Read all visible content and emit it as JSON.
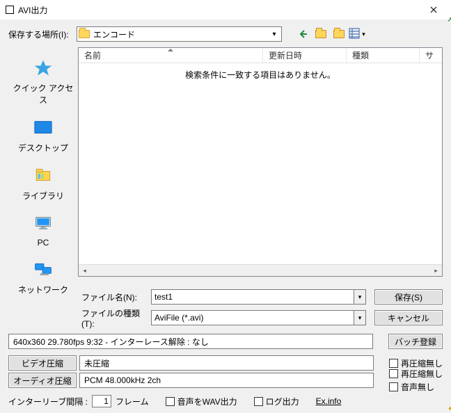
{
  "window": {
    "title": "AVI出力"
  },
  "location": {
    "label": "保存する場所(I):",
    "value": "エンコード"
  },
  "places": {
    "quick": "クイック アクセス",
    "desktop": "デスクトップ",
    "libraries": "ライブラリ",
    "pc": "PC",
    "network": "ネットワーク"
  },
  "listview": {
    "col_name": "名前",
    "col_date": "更新日時",
    "col_type": "種類",
    "col_size": "サ",
    "empty": "検索条件に一致する項目はありません。"
  },
  "file": {
    "name_label": "ファイル名(N):",
    "name_value": "test1",
    "type_label": "ファイルの種類(T):",
    "type_value": "AviFile (*.avi)"
  },
  "buttons": {
    "save": "保存(S)",
    "cancel": "キャンセル",
    "batch": "バッチ登録",
    "video_compress": "ビデオ圧縮",
    "audio_compress": "オーディオ圧縮",
    "exinfo": "Ex.info"
  },
  "info": {
    "video_line": "640x360  29.780fps  9:32  -  インターレース解除 : なし",
    "video_codec": "未圧縮",
    "audio_codec": "PCM 48.000kHz 2ch"
  },
  "checks": {
    "no_recompress": "再圧縮無し",
    "no_recompress2": "再圧縮無し",
    "no_audio": "音声無し",
    "wav_out": "音声をWAV出力",
    "log_out": "ログ出力"
  },
  "interleave": {
    "label": "インターリーブ間隔 :",
    "value": "1",
    "unit": "フレーム"
  }
}
